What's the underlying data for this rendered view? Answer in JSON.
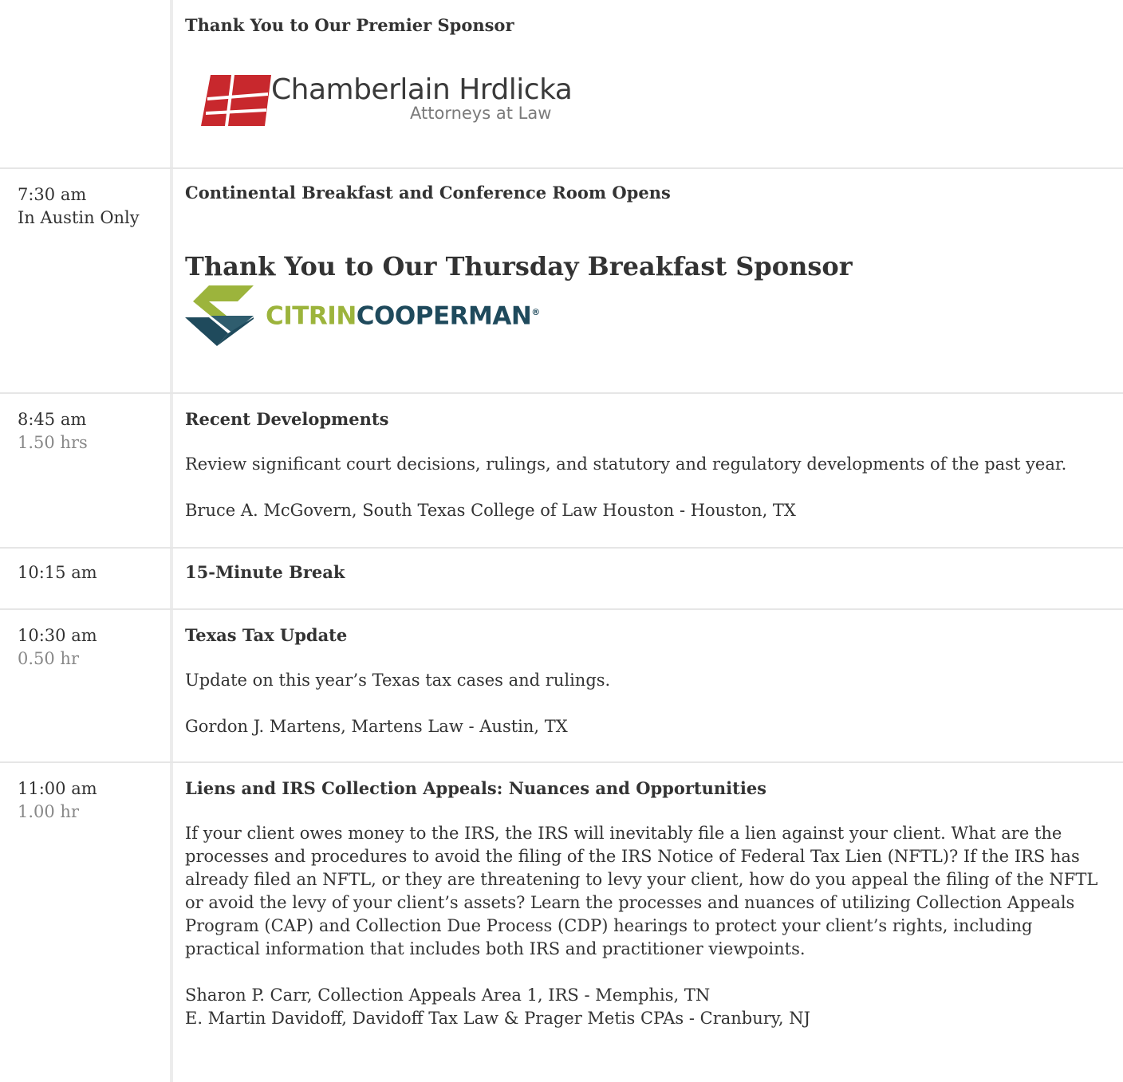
{
  "rows": [
    {
      "time": "",
      "duration": "",
      "title": "Thank You to Our Premier Sponsor",
      "sponsor_logo": {
        "name": "Chamberlain Hrdlicka",
        "tagline": "Attorneys at Law",
        "brand_color": "#c8282d",
        "icon": "chamberlain-hrdlicka-logo"
      }
    },
    {
      "time": "7:30 am",
      "note": "In Austin Only",
      "title": "Continental Breakfast and Conference Room Opens",
      "sponsor_heading": "Thank You to Our Thursday Breakfast Sponsor",
      "sponsor_logo": {
        "name_part1": "CITRIN",
        "name_part2": "COOPERMAN",
        "registered": "®",
        "colors": {
          "green": "#9cb43c",
          "navy": "#1f4a5c"
        },
        "icon": "citrin-cooperman-logo"
      }
    },
    {
      "time": "8:45 am",
      "duration": "1.50 hrs",
      "title": "Recent Developments",
      "description": "Review significant court decisions, rulings, and statutory and regulatory developments of the past year.",
      "speakers": [
        "Bruce A. McGovern, South Texas College of Law Houston - Houston, TX"
      ]
    },
    {
      "time": "10:15 am",
      "duration": "",
      "title": "15-Minute Break"
    },
    {
      "time": "10:30 am",
      "duration": "0.50 hr",
      "title": "Texas Tax Update",
      "description": "Update on this year’s Texas tax cases and rulings.",
      "speakers": [
        "Gordon J. Martens, Martens Law - Austin, TX"
      ]
    },
    {
      "time": "11:00 am",
      "duration": "1.00 hr",
      "title": "Liens and IRS Collection Appeals: Nuances and Opportunities",
      "description": "If your client owes money to the IRS, the IRS will inevitably file a lien against your client. What are the processes and procedures to avoid the filing of the IRS Notice of Federal Tax Lien (NFTL)? If the IRS has already filed an NFTL, or they are threatening to levy your client, how do you appeal the filing of the NFTL or avoid the levy of your client’s assets? Learn the processes and nuances of utilizing Collection Appeals Program (CAP) and Collection Due Process (CDP) hearings to protect your client’s rights, including practical information that includes both IRS and practitioner viewpoints.",
      "speakers": [
        "Sharon P. Carr, Collection Appeals Area 1, IRS - Memphis, TN",
        "E. Martin Davidoff, Davidoff Tax Law & Prager Metis CPAs - Cranbury, NJ"
      ]
    }
  ]
}
